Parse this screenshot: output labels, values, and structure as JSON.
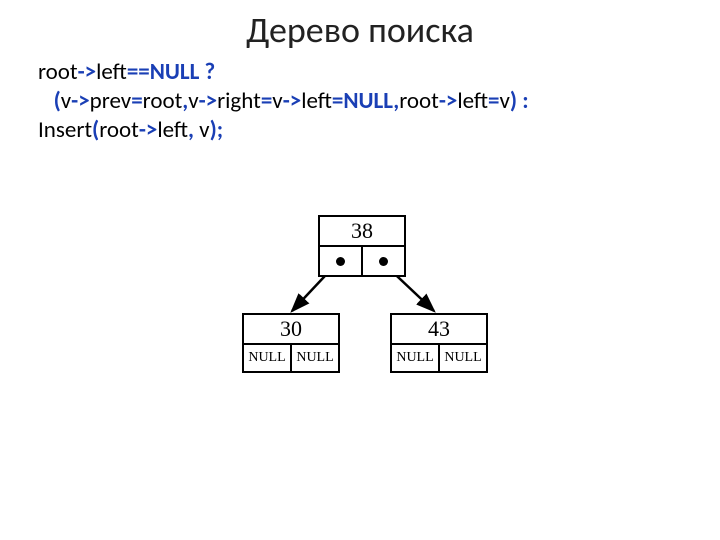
{
  "title": "Дерево поиска",
  "code": {
    "l1": {
      "t1": "root",
      "a1": "->",
      "t2": "left",
      "a2": "==",
      "t3": "NULL ?"
    },
    "l2": {
      "indent": "   ",
      "p1": "(",
      "t1": "v",
      "a1": "->",
      "t2": "prev",
      "eq1": "=",
      "t3": "root",
      "c1": ",",
      "t4": "v",
      "a2": "->",
      "t5": "right",
      "eq2": "=",
      "t6": "v",
      "a3": "->",
      "t7": "left",
      "eq3": "=",
      "t8": "NULL",
      "c2": ",",
      "t9": "root",
      "a4": "->",
      "t10": "left",
      "eq4": "=",
      "t11": "v",
      "p2": ") :"
    },
    "l3": {
      "t1": "Insert",
      "p1": "(",
      "t2": "root",
      "a1": "->",
      "t3": "left",
      "c1": ", ",
      "t4": "v",
      "p2": ");"
    }
  },
  "tree": {
    "root": {
      "value": "38",
      "left": "dot",
      "right": "dot"
    },
    "left": {
      "value": "30",
      "left": "NULL",
      "right": "NULL"
    },
    "right": {
      "value": "43",
      "left": "NULL",
      "right": "NULL"
    }
  },
  "chart_data": {
    "type": "diagram",
    "description": "Binary search tree",
    "nodes": [
      {
        "id": "38",
        "value": 38,
        "children": [
          "30",
          "43"
        ],
        "pointers": [
          "non-null",
          "non-null"
        ]
      },
      {
        "id": "30",
        "value": 30,
        "children": [],
        "pointers": [
          "NULL",
          "NULL"
        ]
      },
      {
        "id": "43",
        "value": 43,
        "children": [],
        "pointers": [
          "NULL",
          "NULL"
        ]
      }
    ],
    "edges": [
      {
        "from": "38",
        "to": "30",
        "side": "left"
      },
      {
        "from": "38",
        "to": "43",
        "side": "right"
      }
    ]
  }
}
